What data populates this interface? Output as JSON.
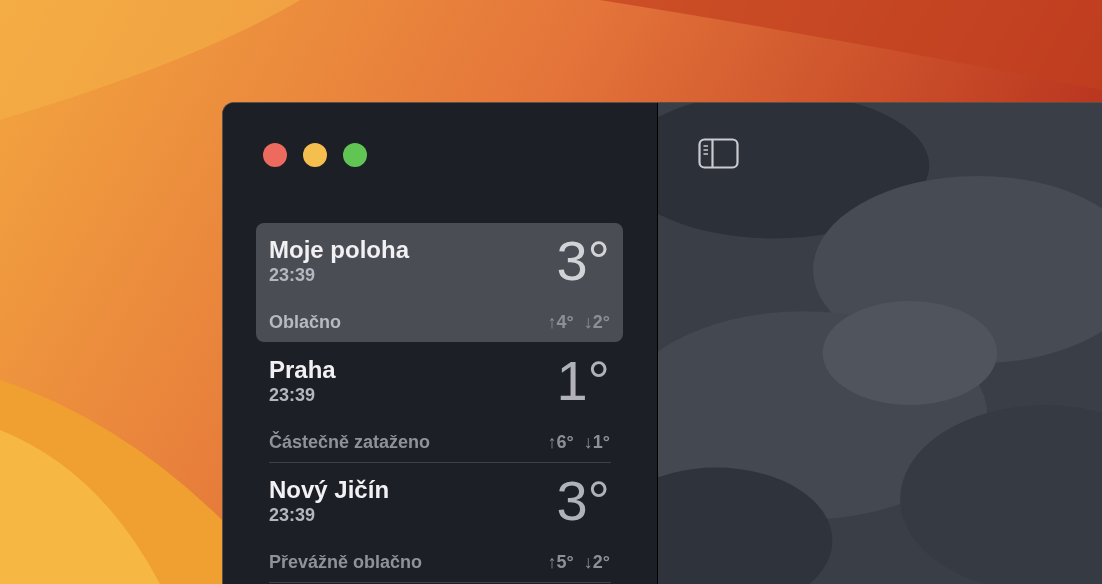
{
  "window": {
    "controls": [
      {
        "color": "#ec6a5e"
      },
      {
        "color": "#f4bf4f"
      },
      {
        "color": "#61c554"
      }
    ]
  },
  "locations": [
    {
      "name": "Moje poloha",
      "time": "23:39",
      "temperature": "3°",
      "condition": "Oblačno",
      "high": "↑4°",
      "low": "↓2°",
      "selected": true
    },
    {
      "name": "Praha",
      "time": "23:39",
      "temperature": "1°",
      "condition": "Částečně zataženo",
      "high": "↑6°",
      "low": "↓1°",
      "selected": false
    },
    {
      "name": "Nový Jičín",
      "time": "23:39",
      "temperature": "3°",
      "condition": "Převážně oblačno",
      "high": "↑5°",
      "low": "↓2°",
      "selected": false
    }
  ]
}
